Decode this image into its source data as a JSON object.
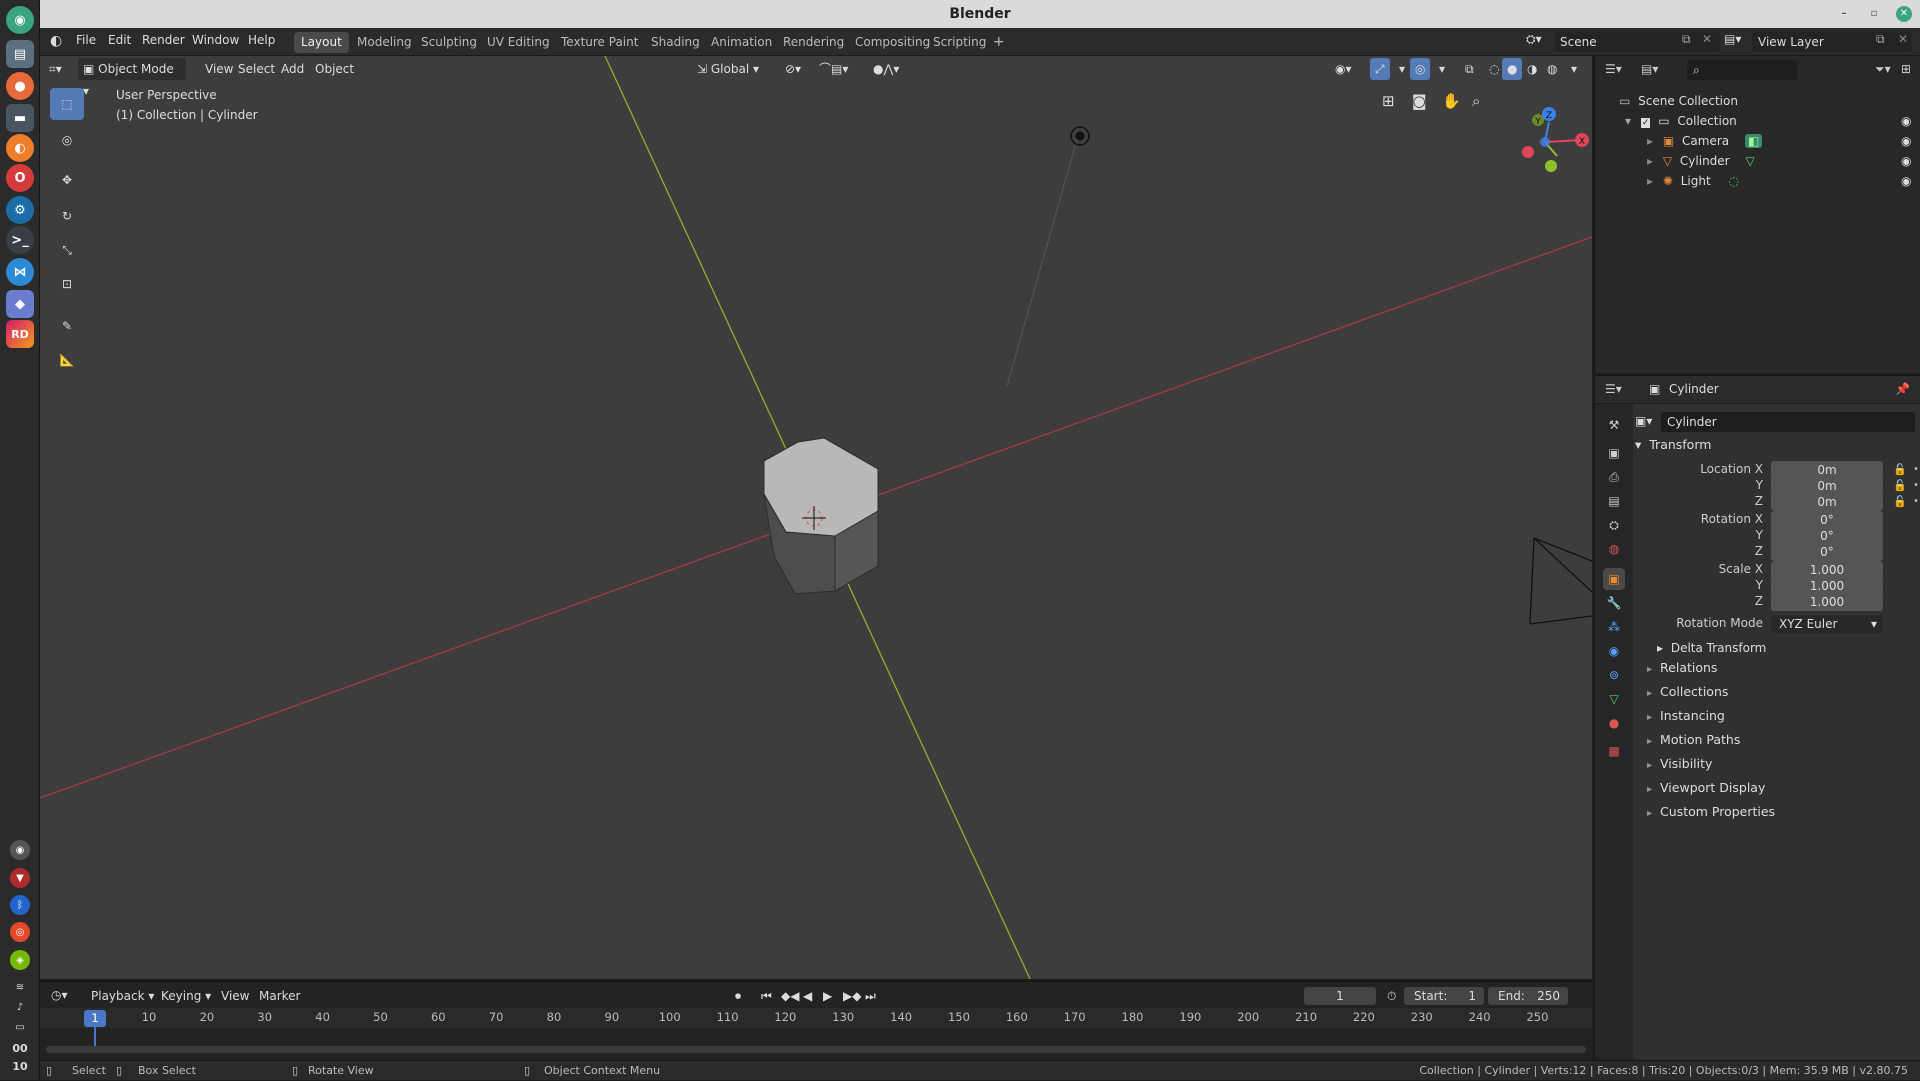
{
  "window": {
    "title": "Blender"
  },
  "topbar": {
    "menus": [
      "File",
      "Edit",
      "Render",
      "Window",
      "Help"
    ],
    "workspaces": [
      "Layout",
      "Modeling",
      "Sculpting",
      "UV Editing",
      "Texture Paint",
      "Shading",
      "Animation",
      "Rendering",
      "Compositing",
      "Scripting"
    ],
    "active_workspace": "Layout",
    "add_workspace": "+",
    "scene": "Scene",
    "view_layer": "View Layer"
  },
  "viewport_header": {
    "mode": "Object Mode",
    "menus": [
      "View",
      "Select",
      "Add",
      "Object"
    ],
    "orientation": "Global"
  },
  "viewport": {
    "perspective_label": "User Perspective",
    "context_label": "(1) Collection | Cylinder",
    "gizmo": {
      "x": "X",
      "y": "Y",
      "z": "Z"
    }
  },
  "outliner": {
    "root": "Scene Collection",
    "collection": "Collection",
    "items": [
      "Camera",
      "Cylinder",
      "Light"
    ]
  },
  "properties": {
    "header_object": "Cylinder",
    "object_name": "Cylinder",
    "transform_title": "Transform",
    "location_label": "Location X",
    "rotation_label": "Rotation X",
    "scale_label": "Scale X",
    "y_label": "Y",
    "z_label": "Z",
    "location": [
      "0m",
      "0m",
      "0m"
    ],
    "rotation": [
      "0°",
      "0°",
      "0°"
    ],
    "scale": [
      "1.000",
      "1.000",
      "1.000"
    ],
    "rotation_mode_label": "Rotation Mode",
    "rotation_mode": "XYZ Euler",
    "delta_transform": "Delta Transform",
    "sections": [
      "Relations",
      "Collections",
      "Instancing",
      "Motion Paths",
      "Visibility",
      "Viewport Display",
      "Custom Properties"
    ]
  },
  "timeline": {
    "menus": [
      "Playback",
      "Keying",
      "View",
      "Marker"
    ],
    "current_frame": "1",
    "start_label": "Start:",
    "start": "1",
    "end_label": "End:",
    "end": "250",
    "ticks": [
      "10",
      "20",
      "30",
      "40",
      "50",
      "60",
      "70",
      "80",
      "90",
      "100",
      "110",
      "120",
      "130",
      "140",
      "150",
      "160",
      "170",
      "180",
      "190",
      "200",
      "210",
      "220",
      "230",
      "240",
      "250"
    ],
    "playhead": "1"
  },
  "statusbar": {
    "select": "Select",
    "box_select": "Box Select",
    "rotate_view": "Rotate View",
    "context_menu": "Object Context Menu",
    "stats": "Collection | Cylinder | Verts:12 | Faces:8 | Tris:20 | Objects:0/3 | Mem: 35.9 MB | v2.80.75"
  },
  "dock": {
    "time_top": "00",
    "time_bottom": "10",
    "rd": "RD"
  },
  "colors": {
    "accent": "#557ab8",
    "x_axis": "#e2455a",
    "y_axis": "#8fc02c",
    "z_axis": "#3b82e8",
    "active_tab": "#4a4a4a"
  }
}
